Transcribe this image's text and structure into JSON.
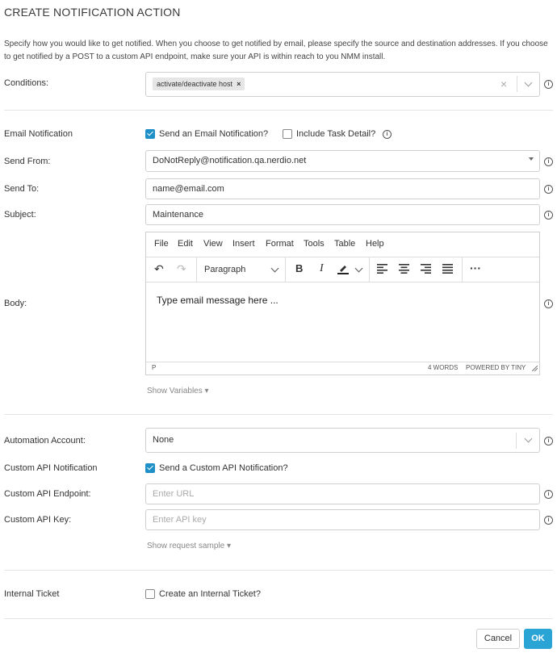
{
  "title": "CREATE NOTIFICATION ACTION",
  "description": "Specify how you would like to get notified. When you choose to get notified by email, please specify the source and destination addresses. If you choose to get notified by a POST to a custom API endpoint, make sure your API is within reach to you NMM install.",
  "conditions": {
    "label": "Conditions:",
    "tag": "activate/deactivate host",
    "tag_remove": "×",
    "clear": "×"
  },
  "email": {
    "label": "Email Notification",
    "send_checkbox": {
      "label": "Send an Email Notification?",
      "checked": true
    },
    "task_detail_checkbox": {
      "label": "Include Task Detail?",
      "checked": false
    },
    "send_from": {
      "label": "Send From:",
      "value": "DoNotReply@notification.qa.nerdio.net"
    },
    "send_to": {
      "label": "Send To:",
      "value": "name@email.com"
    },
    "subject": {
      "label": "Subject:",
      "value": "Maintenance"
    },
    "body": {
      "label": "Body:",
      "menu": [
        "File",
        "Edit",
        "View",
        "Insert",
        "Format",
        "Tools",
        "Table",
        "Help"
      ],
      "block_format": "Paragraph",
      "content": "Type email message here ...",
      "status_path": "P",
      "word_count": "4 WORDS",
      "powered_by": "POWERED BY TINY"
    },
    "show_variables": "Show Variables ▾"
  },
  "automation": {
    "label": "Automation Account:",
    "value": "None"
  },
  "custom_api": {
    "label": "Custom API Notification",
    "send_checkbox": {
      "label": "Send a Custom API Notification?",
      "checked": true
    },
    "endpoint": {
      "label": "Custom API Endpoint:",
      "placeholder": "Enter URL"
    },
    "key": {
      "label": "Custom API Key:",
      "placeholder": "Enter API key"
    },
    "show_request_sample": "Show request sample ▾"
  },
  "internal_ticket": {
    "label": "Internal Ticket",
    "checkbox": {
      "label": "Create an Internal Ticket?",
      "checked": false
    }
  },
  "buttons": {
    "cancel": "Cancel",
    "ok": "OK"
  },
  "colors": {
    "accent": "#1e8fc7",
    "ok_button": "#2aa4d5"
  },
  "info_icon_glyph": "i"
}
